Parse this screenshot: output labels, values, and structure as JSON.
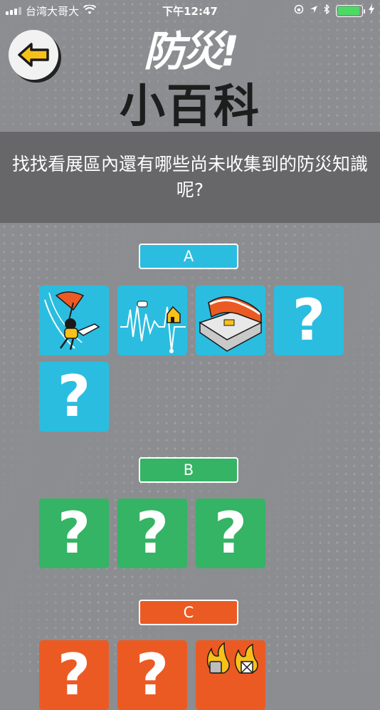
{
  "status_bar": {
    "carrier": "台湾大哥大",
    "time": "下午12:47",
    "battery_level": 0.95
  },
  "header": {
    "logo_line1": "防災!",
    "logo_line2": "小百科"
  },
  "prompt": "找找看展區內還有哪些尚未收集到的防災知識呢?",
  "sections": {
    "a": {
      "label": "A",
      "color": "#2bbde0"
    },
    "b": {
      "label": "B",
      "color": "#34b464"
    },
    "c": {
      "label": "C",
      "color": "#ec5a24"
    }
  },
  "placeholder_glyph": "?",
  "tiles": {
    "a1": {
      "state": "collected",
      "icon": "typhoon-icon"
    },
    "a2": {
      "state": "collected",
      "icon": "earthquake-icon"
    },
    "a3": {
      "state": "collected",
      "icon": "landslide-icon"
    },
    "a4": {
      "state": "locked"
    },
    "a5": {
      "state": "locked"
    },
    "b1": {
      "state": "locked"
    },
    "b2": {
      "state": "locked"
    },
    "b3": {
      "state": "locked"
    },
    "c1": {
      "state": "locked"
    },
    "c2": {
      "state": "locked"
    },
    "c3": {
      "state": "collected",
      "icon": "fire-icon"
    }
  }
}
